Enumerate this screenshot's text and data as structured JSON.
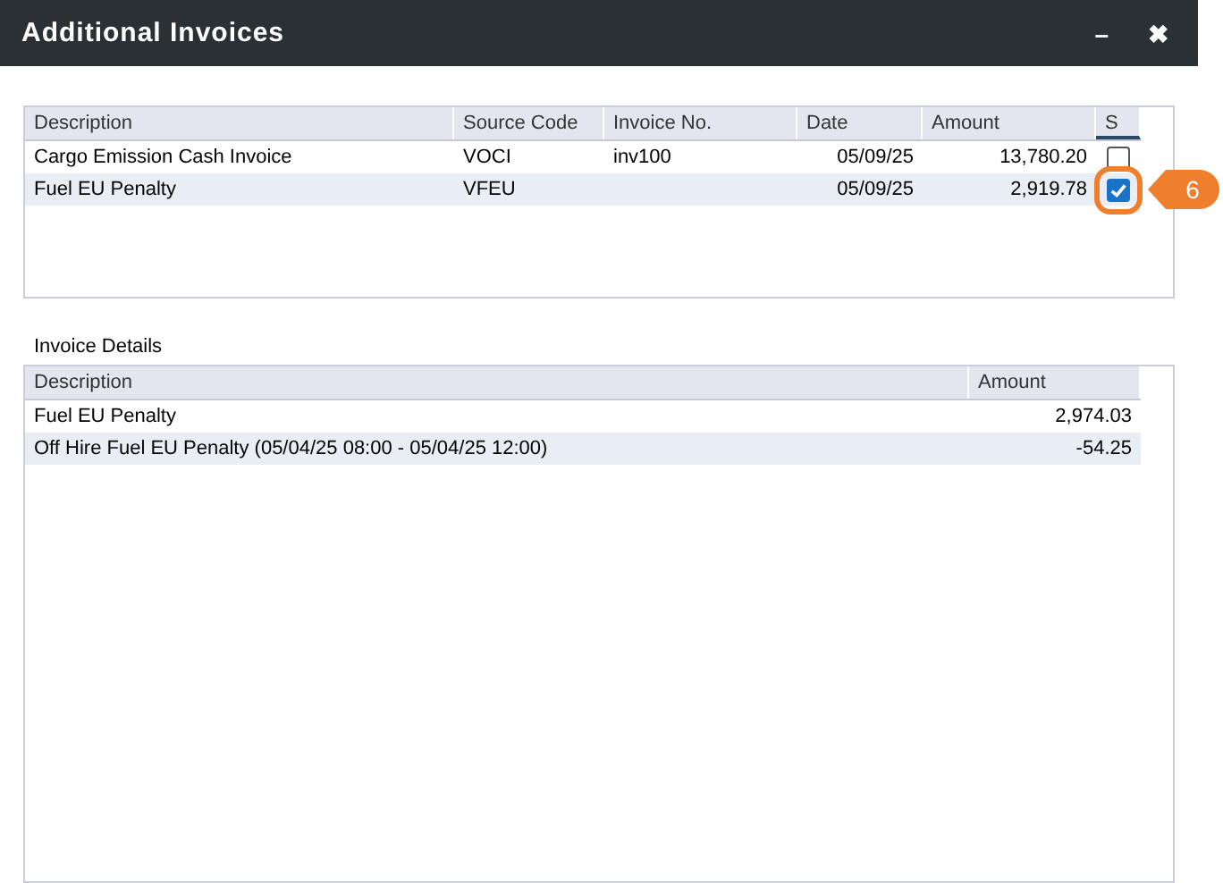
{
  "window": {
    "title": "Additional Invoices",
    "buttons": [
      "–",
      "✖"
    ]
  },
  "invoices": {
    "columns": [
      "Description",
      "Source Code",
      "Invoice No.",
      "Date",
      "Amount",
      "S"
    ],
    "rows": [
      {
        "description": "Cargo Emission Cash Invoice",
        "source_code": "VOCI",
        "invoice_no": "inv100",
        "date": "05/09/25",
        "amount": "13,780.20",
        "checked": false,
        "selected": false,
        "callout": null
      },
      {
        "description": "Fuel EU Penalty",
        "source_code": "VFEU",
        "invoice_no": "",
        "date": "05/09/25",
        "amount": "2,919.78",
        "checked": true,
        "selected": true,
        "callout": "6"
      }
    ]
  },
  "details": {
    "label": "Invoice Details",
    "columns": [
      "Description",
      "Amount"
    ],
    "rows": [
      {
        "description": "Fuel EU Penalty",
        "amount": "2,974.03"
      },
      {
        "description": "Off Hire Fuel EU Penalty (05/04/25 08:00 - 05/04/25 12:00)",
        "amount": "-54.25"
      }
    ]
  }
}
